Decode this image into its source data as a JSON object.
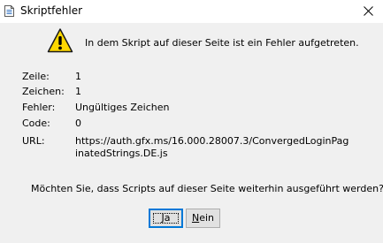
{
  "window": {
    "title": "Skriptfehler",
    "title_icon": "document-icon",
    "close_icon": "close-icon"
  },
  "dialog": {
    "icon": "warning-icon",
    "message": "In dem Skript auf dieser Seite ist ein Fehler aufgetreten.",
    "fields": [
      {
        "label": "Zeile:",
        "value": "1"
      },
      {
        "label": "Zeichen:",
        "value": "1"
      },
      {
        "label": "Fehler:",
        "value": "Ungültiges Zeichen"
      },
      {
        "label": "Code:",
        "value": "0"
      },
      {
        "label": "URL:",
        "value": "https://auth.gfx.ms/16.000.28007.3/ConvergedLoginPaginatedStrings.DE.js"
      }
    ],
    "question": "Möchten Sie, dass Scripts auf dieser Seite weiterhin ausgeführt werden?"
  },
  "buttons": {
    "yes_mnemonic": "J",
    "yes_rest": "a",
    "no_mnemonic": "N",
    "no_rest": "ein"
  },
  "colors": {
    "background": "#f0f0f0",
    "titlebar": "#ffffff",
    "warning_yellow": "#ffd800",
    "focus_blue": "#0078d7"
  }
}
